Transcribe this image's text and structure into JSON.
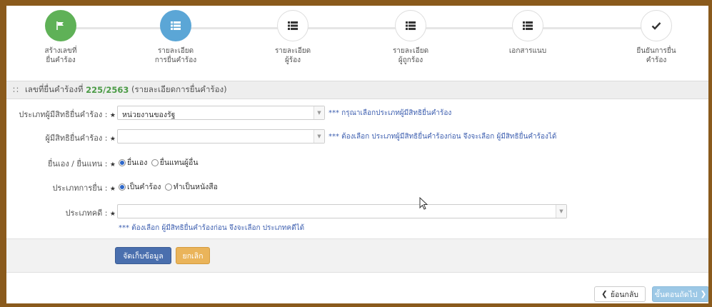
{
  "wizard": {
    "steps": [
      {
        "label1": "สร้างเลขที่",
        "label2": "ยื่นคำร้อง",
        "icon": "flag-icon",
        "state": "done"
      },
      {
        "label1": "รายละเอียด",
        "label2": "การยื่นคำร้อง",
        "icon": "list-icon",
        "state": "active"
      },
      {
        "label1": "รายละเอียด",
        "label2": "ผู้ร้อง",
        "icon": "list-icon",
        "state": "todo"
      },
      {
        "label1": "รายละเอียด",
        "label2": "ผู้ถูกร้อง",
        "icon": "list-icon",
        "state": "todo"
      },
      {
        "label1": "เอกสารแนบ",
        "label2": "",
        "icon": "list-icon",
        "state": "todo"
      },
      {
        "label1": "ยืนยันการยื่น",
        "label2": "คำร้อง",
        "icon": "check-icon",
        "state": "todo"
      }
    ]
  },
  "panel": {
    "title_prefix": "เลขที่ยื่นคำร้องที่",
    "case_number": "225/2563",
    "title_suffix": "(รายละเอียดการยื่นคำร้อง)"
  },
  "form": {
    "claimant_type": {
      "label": "ประเภทผู้มีสิทธิยื่นคำร้อง :",
      "value": "หน่วยงานของรัฐ",
      "hint": "*** กรุณาเลือกประเภทผู้มีสิทธิยื่นคำร้อง"
    },
    "claimant": {
      "label": "ผู้มีสิทธิยื่นคำร้อง :",
      "value": "",
      "hint": "*** ต้องเลือก ประเภทผู้มีสิทธิยื่นคำร้องก่อน จึงจะเลือก ผู้มีสิทธิยื่นคำร้องได้"
    },
    "self_or_proxy": {
      "label": "ยื่นเอง / ยื่นแทน :",
      "option1": "ยื่นเอง",
      "option2": "ยื่นแทนผู้อื่น",
      "selected": "ยื่นเอง"
    },
    "filing_type": {
      "label": "ประเภทการยื่น :",
      "option1": "เป็นคำร้อง",
      "option2": "ทำเป็นหนังสือ",
      "selected": "เป็นคำร้อง"
    },
    "case_type": {
      "label": "ประเภทคดี :",
      "value": "",
      "hint": "*** ต้องเลือก ผู้มีสิทธิยื่นคำร้องก่อน จึงจะเลือก ประเภทคดีได้"
    },
    "required_mark": "★"
  },
  "actions": {
    "save_label": "จัดเก็บข้อมูล",
    "cancel_label": "ยกเลิก"
  },
  "footer": {
    "back_label": "ย้อนกลับ",
    "next_label": "ขั้นตอนถัดไป"
  },
  "colors": {
    "done": "#5fb157",
    "active": "#5ba6d6",
    "save": "#4a6fae",
    "cancel": "#eab45a",
    "hint": "#3f60b0"
  }
}
